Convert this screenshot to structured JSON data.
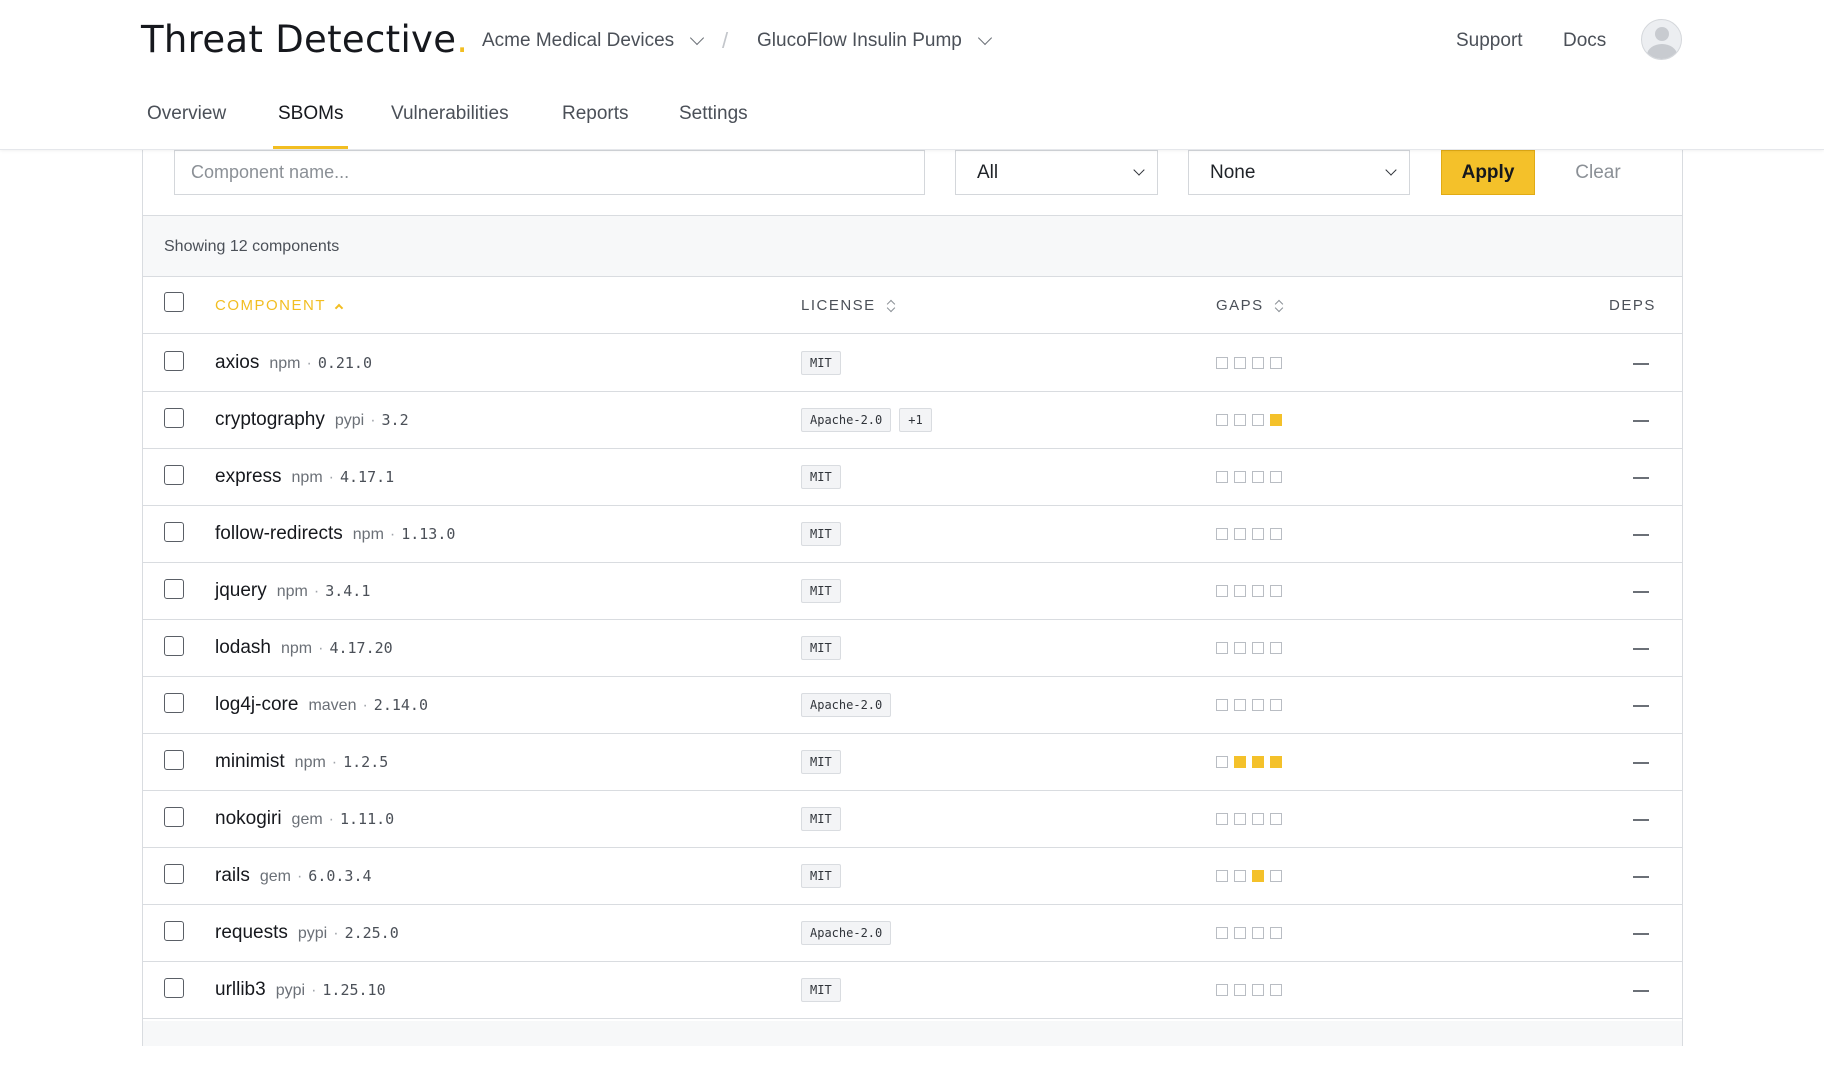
{
  "app": {
    "brand_main": "Threat",
    "brand_second": "Detective",
    "brand_dot": "."
  },
  "breadcrumbs": [
    {
      "label": "Acme Medical Devices"
    },
    {
      "label": "GlucoFlow Insulin Pump"
    }
  ],
  "breadcrumb_separator": "/",
  "top_links": {
    "support": "Support",
    "docs": "Docs"
  },
  "tabs": [
    {
      "label": "Overview",
      "active": false
    },
    {
      "label": "SBOMs",
      "active": true
    },
    {
      "label": "Vulnerabilities",
      "active": false
    },
    {
      "label": "Reports",
      "active": false
    },
    {
      "label": "Settings",
      "active": false
    }
  ],
  "filters": {
    "search_placeholder": "Component name...",
    "search_value": "",
    "select_1_value": "All",
    "select_2_value": "None",
    "apply_label": "Apply",
    "clear_label": "Clear"
  },
  "summary": "Showing 12 components",
  "columns": {
    "component": "COMPONENT",
    "license": "LICENSE",
    "gaps": "GAPS",
    "deps": "DEPS"
  },
  "rows": [
    {
      "name": "axios",
      "eco": "npm",
      "ver": "0.21.0",
      "licenses": [
        "MIT"
      ],
      "gaps": [
        0,
        0,
        0,
        0
      ]
    },
    {
      "name": "cryptography",
      "eco": "pypi",
      "ver": "3.2",
      "licenses": [
        "Apache-2.0",
        "+1"
      ],
      "gaps": [
        0,
        0,
        0,
        1
      ]
    },
    {
      "name": "express",
      "eco": "npm",
      "ver": "4.17.1",
      "licenses": [
        "MIT"
      ],
      "gaps": [
        0,
        0,
        0,
        0
      ]
    },
    {
      "name": "follow-redirects",
      "eco": "npm",
      "ver": "1.13.0",
      "licenses": [
        "MIT"
      ],
      "gaps": [
        0,
        0,
        0,
        0
      ]
    },
    {
      "name": "jquery",
      "eco": "npm",
      "ver": "3.4.1",
      "licenses": [
        "MIT"
      ],
      "gaps": [
        0,
        0,
        0,
        0
      ]
    },
    {
      "name": "lodash",
      "eco": "npm",
      "ver": "4.17.20",
      "licenses": [
        "MIT"
      ],
      "gaps": [
        0,
        0,
        0,
        0
      ]
    },
    {
      "name": "log4j-core",
      "eco": "maven",
      "ver": "2.14.0",
      "licenses": [
        "Apache-2.0"
      ],
      "gaps": [
        0,
        0,
        0,
        0
      ]
    },
    {
      "name": "minimist",
      "eco": "npm",
      "ver": "1.2.5",
      "licenses": [
        "MIT"
      ],
      "gaps": [
        0,
        1,
        1,
        1
      ]
    },
    {
      "name": "nokogiri",
      "eco": "gem",
      "ver": "1.11.0",
      "licenses": [
        "MIT"
      ],
      "gaps": [
        0,
        0,
        0,
        0
      ]
    },
    {
      "name": "rails",
      "eco": "gem",
      "ver": "6.0.3.4",
      "licenses": [
        "MIT"
      ],
      "gaps": [
        0,
        0,
        1,
        0
      ]
    },
    {
      "name": "requests",
      "eco": "pypi",
      "ver": "2.25.0",
      "licenses": [
        "Apache-2.0"
      ],
      "gaps": [
        0,
        0,
        0,
        0
      ]
    },
    {
      "name": "urllib3",
      "eco": "pypi",
      "ver": "1.25.10",
      "licenses": [
        "MIT"
      ],
      "gaps": [
        0,
        0,
        0,
        0
      ]
    }
  ],
  "deps_placeholder": "—",
  "colors": {
    "accent": "#f4c12a"
  },
  "icons": {
    "breadcrumb_chevron": "chevron-down-icon",
    "avatar": "user-avatar-icon",
    "select_chevron": "chevron-down-icon",
    "sort": "sort-icon"
  }
}
